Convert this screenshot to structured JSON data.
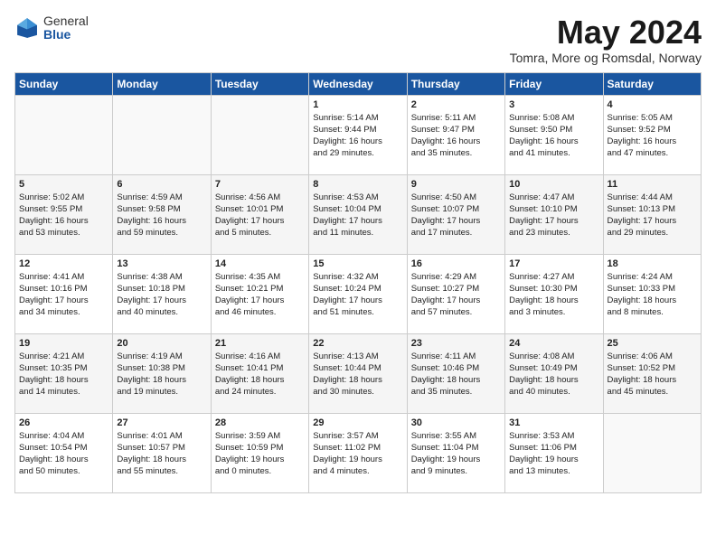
{
  "logo": {
    "general": "General",
    "blue": "Blue"
  },
  "title": "May 2024",
  "subtitle": "Tomra, More og Romsdal, Norway",
  "headers": [
    "Sunday",
    "Monday",
    "Tuesday",
    "Wednesday",
    "Thursday",
    "Friday",
    "Saturday"
  ],
  "weeks": [
    [
      {
        "day": "",
        "info": ""
      },
      {
        "day": "",
        "info": ""
      },
      {
        "day": "",
        "info": ""
      },
      {
        "day": "1",
        "info": "Sunrise: 5:14 AM\nSunset: 9:44 PM\nDaylight: 16 hours\nand 29 minutes."
      },
      {
        "day": "2",
        "info": "Sunrise: 5:11 AM\nSunset: 9:47 PM\nDaylight: 16 hours\nand 35 minutes."
      },
      {
        "day": "3",
        "info": "Sunrise: 5:08 AM\nSunset: 9:50 PM\nDaylight: 16 hours\nand 41 minutes."
      },
      {
        "day": "4",
        "info": "Sunrise: 5:05 AM\nSunset: 9:52 PM\nDaylight: 16 hours\nand 47 minutes."
      }
    ],
    [
      {
        "day": "5",
        "info": "Sunrise: 5:02 AM\nSunset: 9:55 PM\nDaylight: 16 hours\nand 53 minutes."
      },
      {
        "day": "6",
        "info": "Sunrise: 4:59 AM\nSunset: 9:58 PM\nDaylight: 16 hours\nand 59 minutes."
      },
      {
        "day": "7",
        "info": "Sunrise: 4:56 AM\nSunset: 10:01 PM\nDaylight: 17 hours\nand 5 minutes."
      },
      {
        "day": "8",
        "info": "Sunrise: 4:53 AM\nSunset: 10:04 PM\nDaylight: 17 hours\nand 11 minutes."
      },
      {
        "day": "9",
        "info": "Sunrise: 4:50 AM\nSunset: 10:07 PM\nDaylight: 17 hours\nand 17 minutes."
      },
      {
        "day": "10",
        "info": "Sunrise: 4:47 AM\nSunset: 10:10 PM\nDaylight: 17 hours\nand 23 minutes."
      },
      {
        "day": "11",
        "info": "Sunrise: 4:44 AM\nSunset: 10:13 PM\nDaylight: 17 hours\nand 29 minutes."
      }
    ],
    [
      {
        "day": "12",
        "info": "Sunrise: 4:41 AM\nSunset: 10:16 PM\nDaylight: 17 hours\nand 34 minutes."
      },
      {
        "day": "13",
        "info": "Sunrise: 4:38 AM\nSunset: 10:18 PM\nDaylight: 17 hours\nand 40 minutes."
      },
      {
        "day": "14",
        "info": "Sunrise: 4:35 AM\nSunset: 10:21 PM\nDaylight: 17 hours\nand 46 minutes."
      },
      {
        "day": "15",
        "info": "Sunrise: 4:32 AM\nSunset: 10:24 PM\nDaylight: 17 hours\nand 51 minutes."
      },
      {
        "day": "16",
        "info": "Sunrise: 4:29 AM\nSunset: 10:27 PM\nDaylight: 17 hours\nand 57 minutes."
      },
      {
        "day": "17",
        "info": "Sunrise: 4:27 AM\nSunset: 10:30 PM\nDaylight: 18 hours\nand 3 minutes."
      },
      {
        "day": "18",
        "info": "Sunrise: 4:24 AM\nSunset: 10:33 PM\nDaylight: 18 hours\nand 8 minutes."
      }
    ],
    [
      {
        "day": "19",
        "info": "Sunrise: 4:21 AM\nSunset: 10:35 PM\nDaylight: 18 hours\nand 14 minutes."
      },
      {
        "day": "20",
        "info": "Sunrise: 4:19 AM\nSunset: 10:38 PM\nDaylight: 18 hours\nand 19 minutes."
      },
      {
        "day": "21",
        "info": "Sunrise: 4:16 AM\nSunset: 10:41 PM\nDaylight: 18 hours\nand 24 minutes."
      },
      {
        "day": "22",
        "info": "Sunrise: 4:13 AM\nSunset: 10:44 PM\nDaylight: 18 hours\nand 30 minutes."
      },
      {
        "day": "23",
        "info": "Sunrise: 4:11 AM\nSunset: 10:46 PM\nDaylight: 18 hours\nand 35 minutes."
      },
      {
        "day": "24",
        "info": "Sunrise: 4:08 AM\nSunset: 10:49 PM\nDaylight: 18 hours\nand 40 minutes."
      },
      {
        "day": "25",
        "info": "Sunrise: 4:06 AM\nSunset: 10:52 PM\nDaylight: 18 hours\nand 45 minutes."
      }
    ],
    [
      {
        "day": "26",
        "info": "Sunrise: 4:04 AM\nSunset: 10:54 PM\nDaylight: 18 hours\nand 50 minutes."
      },
      {
        "day": "27",
        "info": "Sunrise: 4:01 AM\nSunset: 10:57 PM\nDaylight: 18 hours\nand 55 minutes."
      },
      {
        "day": "28",
        "info": "Sunrise: 3:59 AM\nSunset: 10:59 PM\nDaylight: 19 hours\nand 0 minutes."
      },
      {
        "day": "29",
        "info": "Sunrise: 3:57 AM\nSunset: 11:02 PM\nDaylight: 19 hours\nand 4 minutes."
      },
      {
        "day": "30",
        "info": "Sunrise: 3:55 AM\nSunset: 11:04 PM\nDaylight: 19 hours\nand 9 minutes."
      },
      {
        "day": "31",
        "info": "Sunrise: 3:53 AM\nSunset: 11:06 PM\nDaylight: 19 hours\nand 13 minutes."
      },
      {
        "day": "",
        "info": ""
      }
    ]
  ]
}
